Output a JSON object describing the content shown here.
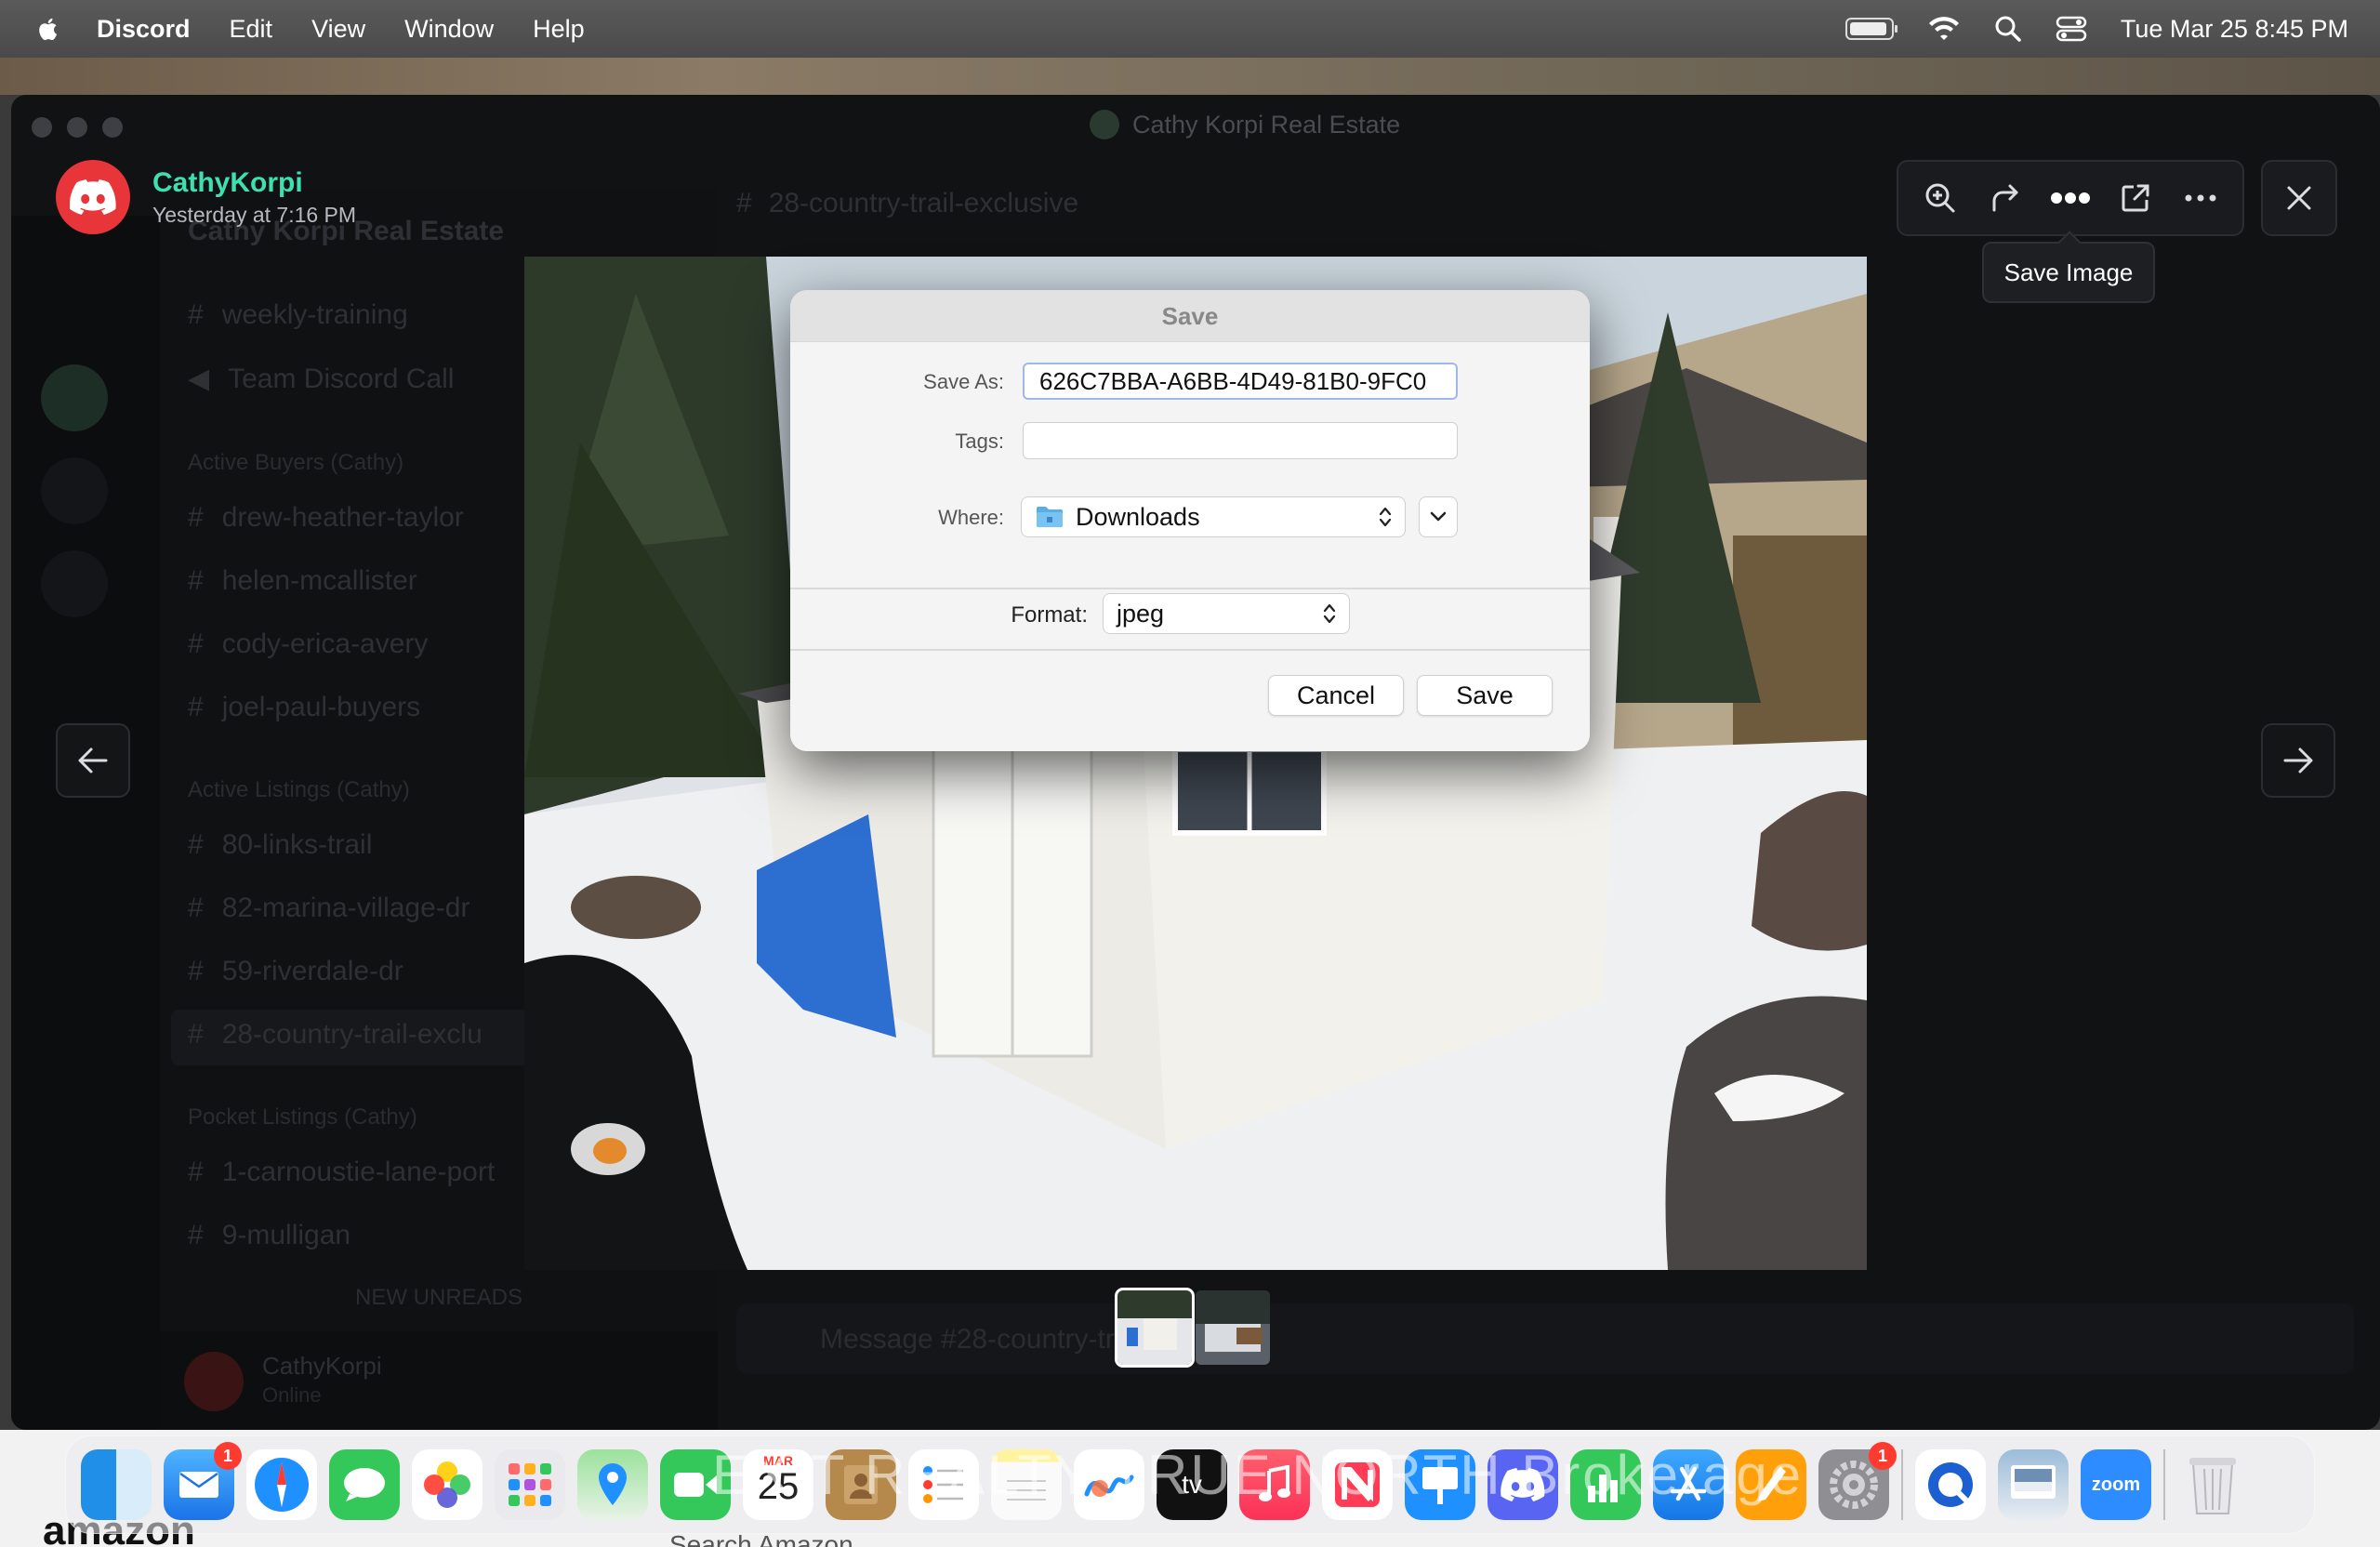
{
  "menubar": {
    "app_name": "Discord",
    "menus": [
      "Edit",
      "View",
      "Window",
      "Help"
    ],
    "datetime": "Tue Mar 25  8:45 PM"
  },
  "window": {
    "title": "Cathy Korpi Real Estate"
  },
  "background": {
    "server_name": "Cathy Korpi Real Estate",
    "channels_top": [
      "weekly-training",
      "Team Discord Call"
    ],
    "category_buyers": "Active Buyers (Cathy)",
    "buyer_channels": [
      "drew-heather-taylor",
      "helen-mcallister",
      "cody-erica-avery",
      "joel-paul-buyers"
    ],
    "category_listings": "Active Listings (Cathy)",
    "listing_channels": [
      "80-links-trail",
      "82-marina-village-dr",
      "59-riverdale-dr",
      "28-country-trail-exclu"
    ],
    "category_pocket": "Pocket Listings (Cathy)",
    "pocket_channels": [
      "1-carnoustie-lane-port",
      "9-mulligan"
    ],
    "new_unreads": "NEW UNREADS",
    "channel_header": "28-country-trail-exclusive",
    "user_name": "CathyKorpi",
    "user_status": "Online",
    "message_placeholder": "Message #28-country-trail-exclusive"
  },
  "viewer": {
    "author_name": "CathyKorpi",
    "author_time": "Yesterday at 7:16 PM",
    "tooltip": "Save Image",
    "toolbar_icons": [
      "zoom-in-icon",
      "forward-icon",
      "more-dots-icon",
      "open-external-icon",
      "ellipsis-icon"
    ]
  },
  "dialog": {
    "title": "Save",
    "save_as_label": "Save As:",
    "save_as_value": "626C7BBA-A6BB-4D49-81B0-9FC0",
    "tags_label": "Tags:",
    "tags_value": "",
    "where_label": "Where:",
    "where_value": "Downloads",
    "format_label": "Format:",
    "format_value": "jpeg",
    "cancel_label": "Cancel",
    "save_label": "Save"
  },
  "dock": {
    "mail_badge": "1",
    "calendar_month": "MAR",
    "calendar_day": "25",
    "settings_badge": "1",
    "zoom_label": "zoom",
    "watermark": "EXIT REALTY TRUE NORTH Brokerage"
  },
  "below_window": {
    "amazon": "amazon",
    "search_text": "Search Amazon"
  },
  "colors": {
    "discord_red": "#e8353a",
    "author_green": "#3ee0b0",
    "mail_badge": "#ff3b30"
  }
}
